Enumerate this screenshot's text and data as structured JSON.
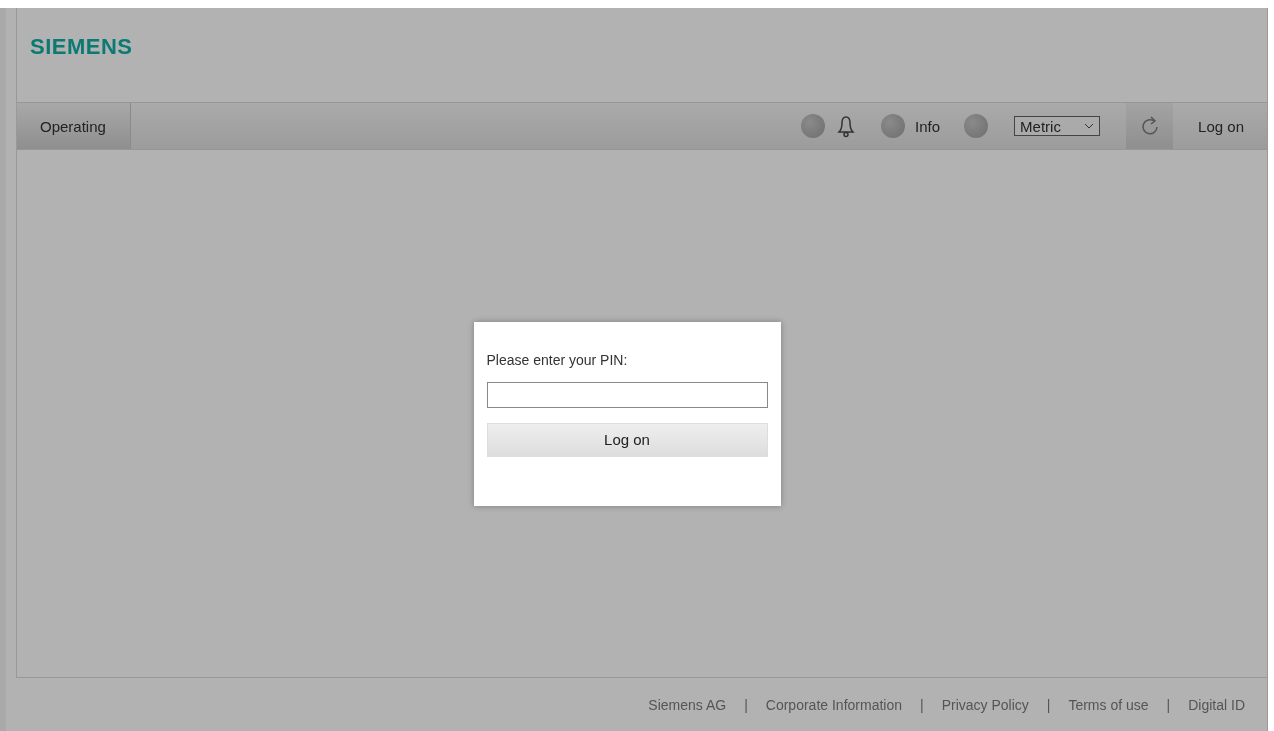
{
  "header": {
    "logo": "SIEMENS"
  },
  "nav": {
    "tab": "Operating",
    "info_label": "Info",
    "unit_select": "Metric",
    "log_on": "Log on"
  },
  "dialog": {
    "prompt": "Please enter your PIN:",
    "button": "Log on"
  },
  "footer": [
    {
      "kind": "link",
      "text": "Siemens AG"
    },
    {
      "kind": "separator",
      "text": "|"
    },
    {
      "kind": "link",
      "text": "Corporate Information"
    },
    {
      "kind": "separator",
      "text": "|"
    },
    {
      "kind": "link",
      "text": "Privacy Policy"
    },
    {
      "kind": "separator",
      "text": "|"
    },
    {
      "kind": "link",
      "text": "Terms of use"
    },
    {
      "kind": "separator",
      "text": "|"
    },
    {
      "kind": "link",
      "text": "Digital ID"
    }
  ]
}
